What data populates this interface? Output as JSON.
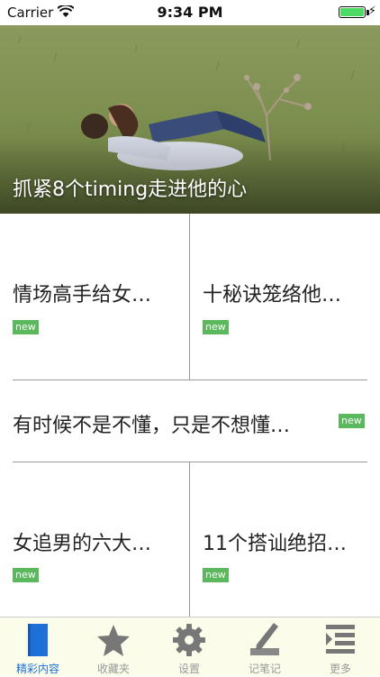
{
  "status_bar": {
    "carrier": "Carrier",
    "time": "9:34 PM"
  },
  "hero": {
    "title": "抓紧8个timing走进他的心"
  },
  "articles": [
    {
      "title": "情场高手给女…",
      "badge": "new"
    },
    {
      "title": "十秘诀笼络他…",
      "badge": "new"
    },
    {
      "title": "有时候不是不懂，只是不想懂…",
      "badge": "new"
    },
    {
      "title": "女追男的六大…",
      "badge": "new"
    },
    {
      "title": "11个搭讪绝招…",
      "badge": "new"
    }
  ],
  "tabs": [
    {
      "label": "精彩内容",
      "icon": "book-icon",
      "active": true
    },
    {
      "label": "收藏夹",
      "icon": "star-icon",
      "active": false
    },
    {
      "label": "设置",
      "icon": "gear-icon",
      "active": false
    },
    {
      "label": "记笔记",
      "icon": "pen-icon",
      "active": false
    },
    {
      "label": "更多",
      "icon": "list-icon",
      "active": false
    }
  ],
  "colors": {
    "accent": "#1e6fd6",
    "badge": "#5cb85c",
    "tabbar_bg": "#fbfdea",
    "inactive": "#999999"
  }
}
